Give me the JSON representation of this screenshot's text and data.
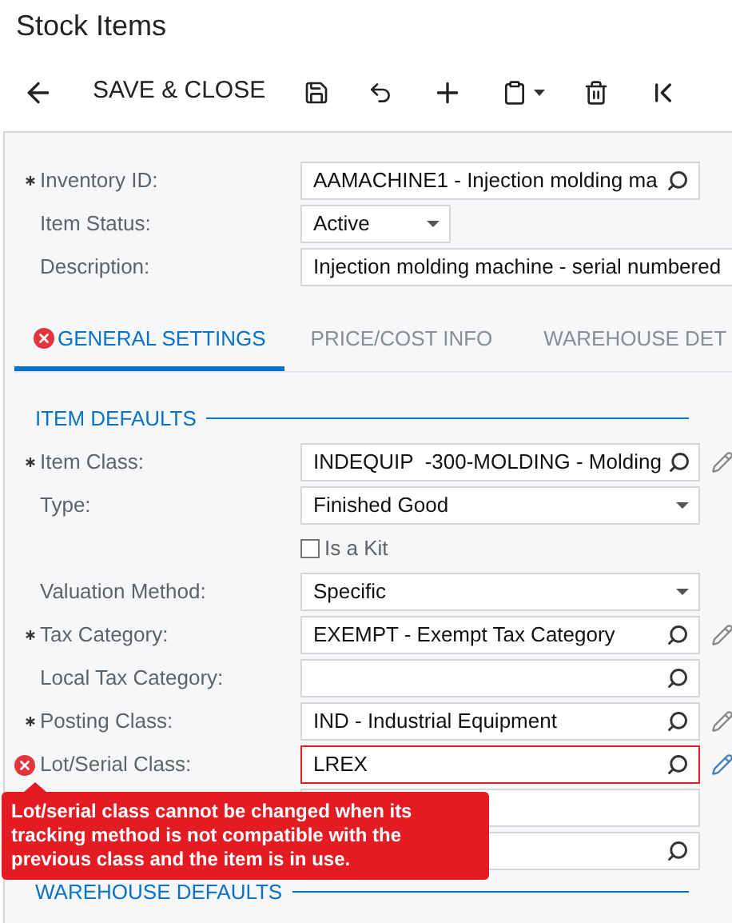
{
  "title": "Stock Items",
  "toolbar": {
    "save_close": "SAVE & CLOSE"
  },
  "header_fields": [
    {
      "kind": "lookup",
      "label": "Inventory ID:",
      "required": true,
      "value": "AAMACHINE1 - Injection molding ma"
    },
    {
      "kind": "select",
      "label": "Item Status:",
      "value": "Active",
      "narrow": true
    },
    {
      "kind": "text",
      "label": "Description:",
      "value": "Injection molding machine - serial numbered",
      "wide": true
    }
  ],
  "tabs": [
    {
      "label": "GENERAL SETTINGS",
      "selected": true,
      "error": true
    },
    {
      "label": "PRICE/COST INFO",
      "selected": false,
      "error": false
    },
    {
      "label": "WAREHOUSE DET",
      "selected": false,
      "error": false
    }
  ],
  "section": "ITEM DEFAULTS",
  "fields": [
    {
      "kind": "lookup",
      "label": "Item Class:",
      "required": true,
      "value": "INDEQUIP  -300-MOLDING - Molding",
      "editable": true
    },
    {
      "kind": "select",
      "label": "Type:",
      "value": "Finished Good"
    },
    {
      "kind": "checkbox",
      "label": "Is a Kit",
      "checked": false
    },
    {
      "kind": "select",
      "label": "Valuation Method:",
      "value": "Specific"
    },
    {
      "kind": "lookup",
      "label": "Tax Category:",
      "required": true,
      "value": "EXEMPT - Exempt Tax Category",
      "editable": true
    },
    {
      "kind": "lookup",
      "label": "Local Tax Category:"
    },
    {
      "kind": "lookup",
      "label": "Posting Class:",
      "required": true,
      "value": "IND - Industrial Equipment",
      "editable": true
    },
    {
      "kind": "lookup",
      "label": "Lot/Serial Class:",
      "value": "LREX",
      "editable": true,
      "error": "Lot/serial class cannot be changed when its tracking method is not compatible with the previous class and the item is in use."
    },
    {
      "kind": "text"
    },
    {
      "kind": "lookup"
    }
  ],
  "next_section": "WAREHOUSE DEFAULTS"
}
